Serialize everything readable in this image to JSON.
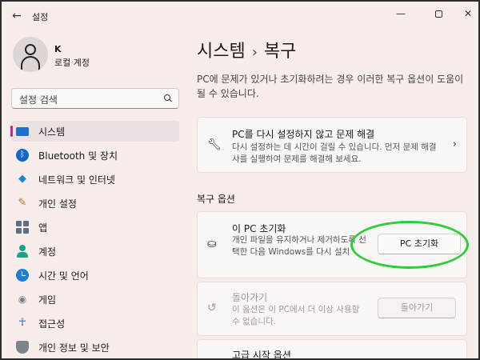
{
  "window": {
    "app_title": "설정",
    "back_label": "←",
    "minimize": "—",
    "close": "✕"
  },
  "user": {
    "name": "K",
    "account_type": "로컬 계정"
  },
  "search": {
    "placeholder": "설정 검색"
  },
  "sidebar": {
    "items": [
      {
        "label": "시스템",
        "icon": "monitor-icon",
        "active": true
      },
      {
        "label": "Bluetooth 및 장치",
        "icon": "bluetooth-icon"
      },
      {
        "label": "네트워크 및 인터넷",
        "icon": "wifi-icon"
      },
      {
        "label": "개인 설정",
        "icon": "brush-icon"
      },
      {
        "label": "앱",
        "icon": "apps-icon"
      },
      {
        "label": "계정",
        "icon": "person-icon"
      },
      {
        "label": "시간 및 언어",
        "icon": "clock-icon"
      },
      {
        "label": "게임",
        "icon": "gamepad-icon"
      },
      {
        "label": "접근성",
        "icon": "accessibility-icon"
      },
      {
        "label": "개인 정보 및 보안",
        "icon": "shield-icon"
      }
    ]
  },
  "main": {
    "breadcrumb_parent": "시스템",
    "breadcrumb_sep": "›",
    "breadcrumb_current": "복구",
    "description": "PC에 문제가 있거나 초기화하려는 경우 이러한 복구 옵션이 도움이 될 수 있습니다.",
    "troubleshoot_card": {
      "title": "PC를 다시 설정하지 않고 문제 해결",
      "desc": "다시 설정하는 데 시간이 걸릴 수 있습니다. 먼저 문제 해결사를 실행하여 문제를 해결해 보세요.",
      "chevron": "›"
    },
    "section_title": "복구 옵션",
    "reset_card": {
      "title": "이 PC 초기화",
      "desc": "개인 파일을 유지하거나 제거하도록 선택한 다음 Windows를 다시 설치",
      "button": "PC 초기화"
    },
    "goback_card": {
      "title": "돌아가기",
      "desc": "이 옵션은 이 PC에서 더 이상 사용할 수 없습니다.",
      "button": "돌아가기"
    },
    "advanced_card": {
      "title": "고급 시작 옵션"
    }
  },
  "colors": {
    "accent": "#c42b8a",
    "highlight": "#2bd134",
    "background": "#f7eeec"
  }
}
